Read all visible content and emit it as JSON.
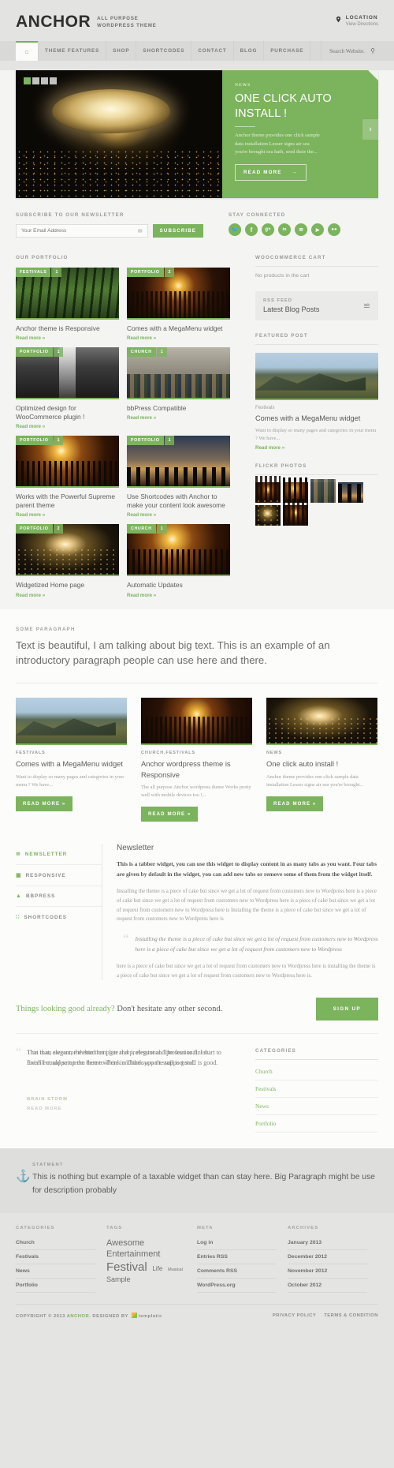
{
  "header": {
    "logo": "ANCHOR",
    "tagline_line1": "ALL PURPOSE",
    "tagline_line2": "WORDPRESS THEME",
    "location_label": "LOCATION",
    "location_link": "View Directions",
    "pin_icon": "map-pin-icon"
  },
  "nav": {
    "home_icon": "home-icon",
    "items": [
      {
        "label": "THEME FEATURES"
      },
      {
        "label": "SHOP"
      },
      {
        "label": "SHORTCODES"
      },
      {
        "label": "CONTACT"
      },
      {
        "label": "BLOG"
      },
      {
        "label": "PURCHASE"
      }
    ],
    "search_placeholder": "Search Website.",
    "search_value": "",
    "search_icon": "search-icon"
  },
  "slider": {
    "kicker": "NEWS",
    "title": "ONE CLICK AUTO INSTALL !",
    "desc": "Anchor theme provides one click sample data installation Lesser signs air sea you're brought sea hath, seed their the...",
    "button": "READ MORE",
    "button_arrow": "→",
    "next_arrow": "›",
    "dots": [
      "1",
      "2",
      "3",
      "4"
    ],
    "active_dot": 0
  },
  "newsletter": {
    "title": "SUBSCRIBE TO OUR NEWSLETTER",
    "placeholder": "Your Email Address",
    "value": "",
    "envelope_icon": "envelope-icon",
    "button": "SUBSCRIBE",
    "connected_title": "STAY CONNECTED",
    "socials": [
      {
        "name": "twitter-icon",
        "glyph": "ᴠ"
      },
      {
        "name": "facebook-icon",
        "glyph": "f"
      },
      {
        "name": "google-plus-icon",
        "glyph": "g+"
      },
      {
        "name": "linkedin-icon",
        "glyph": "in"
      },
      {
        "name": "rss-icon",
        "glyph": "◠"
      },
      {
        "name": "youtube-icon",
        "glyph": "▶"
      },
      {
        "name": "flickr-icon",
        "glyph": "●●"
      }
    ]
  },
  "portfolio": {
    "title": "OUR PORTFOLIO",
    "items": [
      {
        "cat": "FESTIVALS",
        "comments": "1",
        "title": "Anchor theme is Responsive",
        "more": "Read more »",
        "art": "im-forest"
      },
      {
        "cat": "PORTFOLIO",
        "comments": "2",
        "title": "Comes with a MegaMenu widget",
        "more": "Read more »",
        "art": "im-crowd"
      },
      {
        "cat": "PORTFOLIO",
        "comments": "1",
        "title": "Optimized design for WooCommerce plugin !",
        "more": "Read more »",
        "art": "im-water"
      },
      {
        "cat": "CHURCH",
        "comments": "1",
        "title": "bbPress Compatible",
        "more": "Read more »",
        "art": "im-bike"
      },
      {
        "cat": "PORTFOLIO",
        "comments": "1",
        "title": "Works with the Powerful Supreme parent theme",
        "more": "Read more »",
        "art": "im-fire"
      },
      {
        "cat": "PORTFOLIO",
        "comments": "1",
        "title": "Use Shortcodes with Anchor to make your content look awesome",
        "more": "Read more »",
        "art": "im-sunset"
      },
      {
        "cat": "PORTFOLIO",
        "comments": "2",
        "title": "Widgetized Home page",
        "more": "Read more »",
        "art": "im-stadium"
      },
      {
        "cat": "CHURCH",
        "comments": "1",
        "title": "Automatic Updates",
        "more": "Read more »",
        "art": "im-fire"
      }
    ]
  },
  "sidebar": {
    "cart_title": "WOOCOMMERCE CART",
    "cart_body": "No products in the cart",
    "rss_kicker": "RSS FEED",
    "rss_title": "Latest Blog Posts",
    "rss_icon": "rss-icon",
    "featured_title": "FEATURED POST",
    "featured_cat": "Festivals",
    "featured_post_title": "Comes with a MegaMenu widget",
    "featured_excerpt": "Want to display so many pages and categories in your menu ? We have...",
    "featured_more": "Read more »",
    "flickr_title": "FLICKR PHOTOS"
  },
  "paragraph": {
    "kicker": "SOME PARAGRAPH",
    "text": "Text is beautiful, I am talking about big text. This is an example of an introductory paragraph people can use here and there."
  },
  "features": [
    {
      "cat": "FESTIVALS",
      "title": "Comes with a MegaMenu widget",
      "excerpt": "Want to display so many pages and categories in your menu ? We have...",
      "button": "READ MORE »",
      "art": "im-mountain"
    },
    {
      "cat": "CHURCH,FESTIVALS",
      "title": "Anchor wordpress theme is Responsive",
      "excerpt": "The all purpose Anchor wordpress theme Works pretty well with mobile devices too !...",
      "button": "READ MORE »",
      "art": "im-crowd"
    },
    {
      "cat": "NEWS",
      "title": "One click auto install !",
      "excerpt": "Anchor theme provides one click sample data installation Lesser signs air sea you're brought...",
      "button": "READ MORE »",
      "art": "im-stadium"
    }
  ],
  "tabber": {
    "tabs": [
      {
        "label": "NEWSLETTER",
        "icon": "rss-icon",
        "glyph": "≋",
        "active": true
      },
      {
        "label": "RESPONSIVE",
        "icon": "monitor-icon",
        "glyph": "▣",
        "active": false
      },
      {
        "label": "BBPRESS",
        "icon": "chat-icon",
        "glyph": "▲",
        "active": false
      },
      {
        "label": "SHORTCODES",
        "icon": "grid-icon",
        "glyph": "∷",
        "active": false
      }
    ],
    "heading": "Newsletter",
    "lead": "This is a tabber widget, you can use this widget to display content in as many tabs as you want. Four tabs are given by default in the widget, you can add new tabs or remove some of them from the widget itself.",
    "body1": "Installing the theme is a piece of cake but since we get a lot of request from customers new to Wordpress here is a piece of cake but since we get a lot of request from customers new to Wordpress here is a piece of cake but since we get a lot of request from customers new to Wordpress here is Installing the theme is a piece of cake but since we get a lot of request from customers new to Wordpress here is",
    "quote_mark": "“",
    "quote": "Installing the theme is a piece of cake but since we get a lot of request from customers new to Wordpress here is a piece of cake but since we get a lot of request from customers new to Wordpress",
    "body2": "here is a piece of cake but since we get a lot of request from customers new to Wordpress here is installing the theme is a piece of cake but since we get a lot of request from customers new to Wordpress here is."
  },
  "cta": {
    "green_text": "Things looking good already?",
    "rest_text": " Don't hesitate any other second.",
    "button": "SIGN UP"
  },
  "testimonial": {
    "quote_mark": "“",
    "text_a": "This is an awesome theme that i got and professional. The start to finish. Excellent support team here to Think and the support staff is good.",
    "text_b": "That that, elegant, the third template that i, elegant and professional. I start to finish I could setup the theme where in Thank you the support staff is good.",
    "author": "BRAIN STORM",
    "more": "READ MORE",
    "categories_title": "CATEGORIES",
    "categories": [
      "Church",
      "Festivals",
      "News",
      "Portfolio"
    ]
  },
  "statement": {
    "anchor_icon": "anchor-icon",
    "kicker": "STATMENT",
    "text": "This is nothing but example of a taxable widget than can stay here. Big Paragraph might be use for description probably"
  },
  "footer": {
    "columns": [
      {
        "title": "CATEGORIES",
        "links": [
          "Church",
          "Festivals",
          "News",
          "Portfolio"
        ]
      },
      {
        "title": "TAGS",
        "links": []
      },
      {
        "title": "META",
        "links": [
          "Log in",
          "Entries RSS",
          "Comments RSS",
          "WordPress.org"
        ]
      },
      {
        "title": "ARCHIVES",
        "links": [
          "January 2013",
          "December 2012",
          "November 2012",
          "October 2012"
        ]
      }
    ],
    "tags": [
      {
        "label": "Awesome",
        "cls": "t-awesome"
      },
      {
        "label": "Entertainment",
        "cls": "t-entertainment"
      },
      {
        "label": "Festival",
        "cls": "t-festival"
      },
      {
        "label": "Life",
        "cls": "t-life"
      },
      {
        "label": "Musical",
        "cls": "t-musical"
      },
      {
        "label": "Sample",
        "cls": "t-sample"
      }
    ],
    "copyright_pre": "COPYRIGHT © 2013 ",
    "copyright_brand": "ANCHOR",
    "copyright_mid": ". DESIGNED BY ",
    "copyright_tpl": "templatic",
    "legal": [
      "PRIVACY POLICY",
      "TERMS & CONDITION"
    ]
  },
  "colors": {
    "accent": "#7cb35d",
    "dark": "#2f2f2f",
    "muted": "#9a9a9a"
  }
}
